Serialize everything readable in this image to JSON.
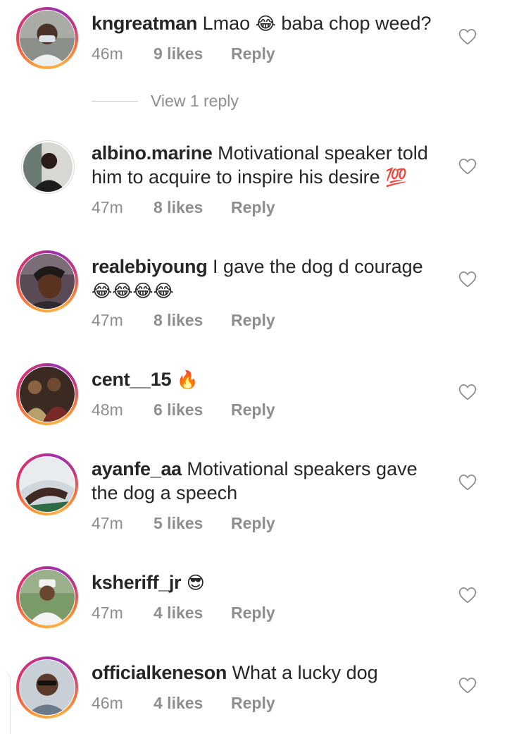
{
  "colors": {
    "text": "#262626",
    "secondary": "#8e8e8e",
    "story_ring_start": "#f9a13a",
    "story_ring_end": "#c13584"
  },
  "comments": [
    {
      "username": "kngreatman",
      "text": "Lmao",
      "emoji": "😂",
      "text2": "baba chop weed?",
      "time": "46m",
      "likes": "9 likes",
      "reply": "Reply",
      "avatar": "person-mask-avatar",
      "story_ring": true
    },
    {
      "username": "albino.marine",
      "text": "Motivational speaker told him to acquire to inspire his desire",
      "emoji": "💯",
      "time": "47m",
      "likes": "8 likes",
      "reply": "Reply",
      "avatar": "person-dark-avatar",
      "story_ring": false
    },
    {
      "username": "realebiyoung",
      "text": "I gave the dog d courage",
      "emoji": "😂😂😂😂",
      "time": "47m",
      "likes": "8 likes",
      "reply": "Reply",
      "avatar": "woman-selfie-avatar",
      "story_ring": true
    },
    {
      "username": "cent__15",
      "emoji": "🔥",
      "time": "48m",
      "likes": "6 likes",
      "reply": "Reply",
      "avatar": "group-photo-avatar",
      "story_ring": true
    },
    {
      "username": "ayanfe_aa",
      "text": "Motivational speakers gave the dog a speech",
      "time": "47m",
      "likes": "5 likes",
      "reply": "Reply",
      "avatar": "lying-person-avatar",
      "story_ring": true
    },
    {
      "username": "ksheriff_jr",
      "emoji": "😎",
      "time": "47m",
      "likes": "4 likes",
      "reply": "Reply",
      "avatar": "man-white-cap-avatar",
      "story_ring": true
    },
    {
      "username": "officialkeneson",
      "text": "What a lucky dog",
      "time": "46m",
      "likes": "4 likes",
      "reply": "Reply",
      "avatar": "man-sunglasses-avatar",
      "story_ring": true
    }
  ],
  "view_replies": "View 1 reply"
}
